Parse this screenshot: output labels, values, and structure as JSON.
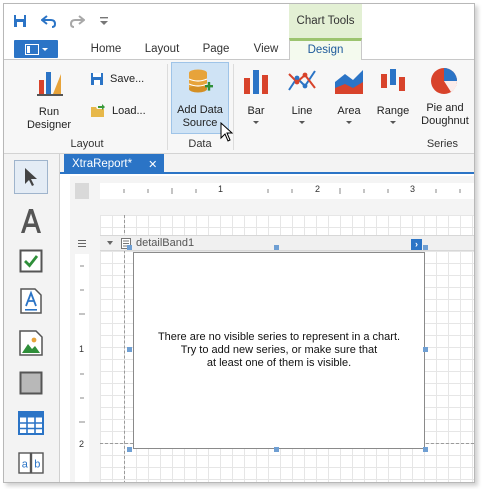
{
  "quick_access": {
    "undo_icon": "undo-icon",
    "redo_icon": "redo-icon",
    "customize_icon": "customize-qat-icon"
  },
  "context_group": "Chart Tools",
  "tabs": [
    "Home",
    "Layout",
    "Page",
    "View",
    "Design"
  ],
  "active_tab": "Design",
  "ribbon": {
    "layout_group": {
      "label": "Layout",
      "run_designer": "Run Designer",
      "save": "Save...",
      "load": "Load..."
    },
    "data_group": {
      "label": "Data",
      "add_data_source_line1": "Add Data",
      "add_data_source_line2": "Source"
    },
    "series_group": {
      "label": "Series",
      "bar": "Bar",
      "line": "Line",
      "area": "Area",
      "range": "Range",
      "pie_line1": "Pie and",
      "pie_line2": "Doughnut"
    }
  },
  "document_tab": {
    "title": "XtraReport*",
    "close": "✕"
  },
  "ruler": {
    "h_marks": [
      "1",
      "2",
      "3"
    ],
    "v_marks": [
      "1",
      "2"
    ]
  },
  "band": {
    "name": "detailBand1"
  },
  "chart": {
    "message_line1": "There are no visible series to represent in a chart.",
    "message_line2": "Try to add new series, or make sure that",
    "message_line3": "at least one of them is visible."
  },
  "toolbox": [
    "pointer-tool",
    "label-tool",
    "checkbox-tool",
    "rich-text-tool",
    "picture-box-tool",
    "panel-tool",
    "table-tool",
    "character-comb-tool"
  ],
  "colors": {
    "accent": "#2b74c6",
    "context_green": "#9cc46f",
    "chart_red": "#d8432b",
    "chart_blue": "#2b74c6"
  }
}
